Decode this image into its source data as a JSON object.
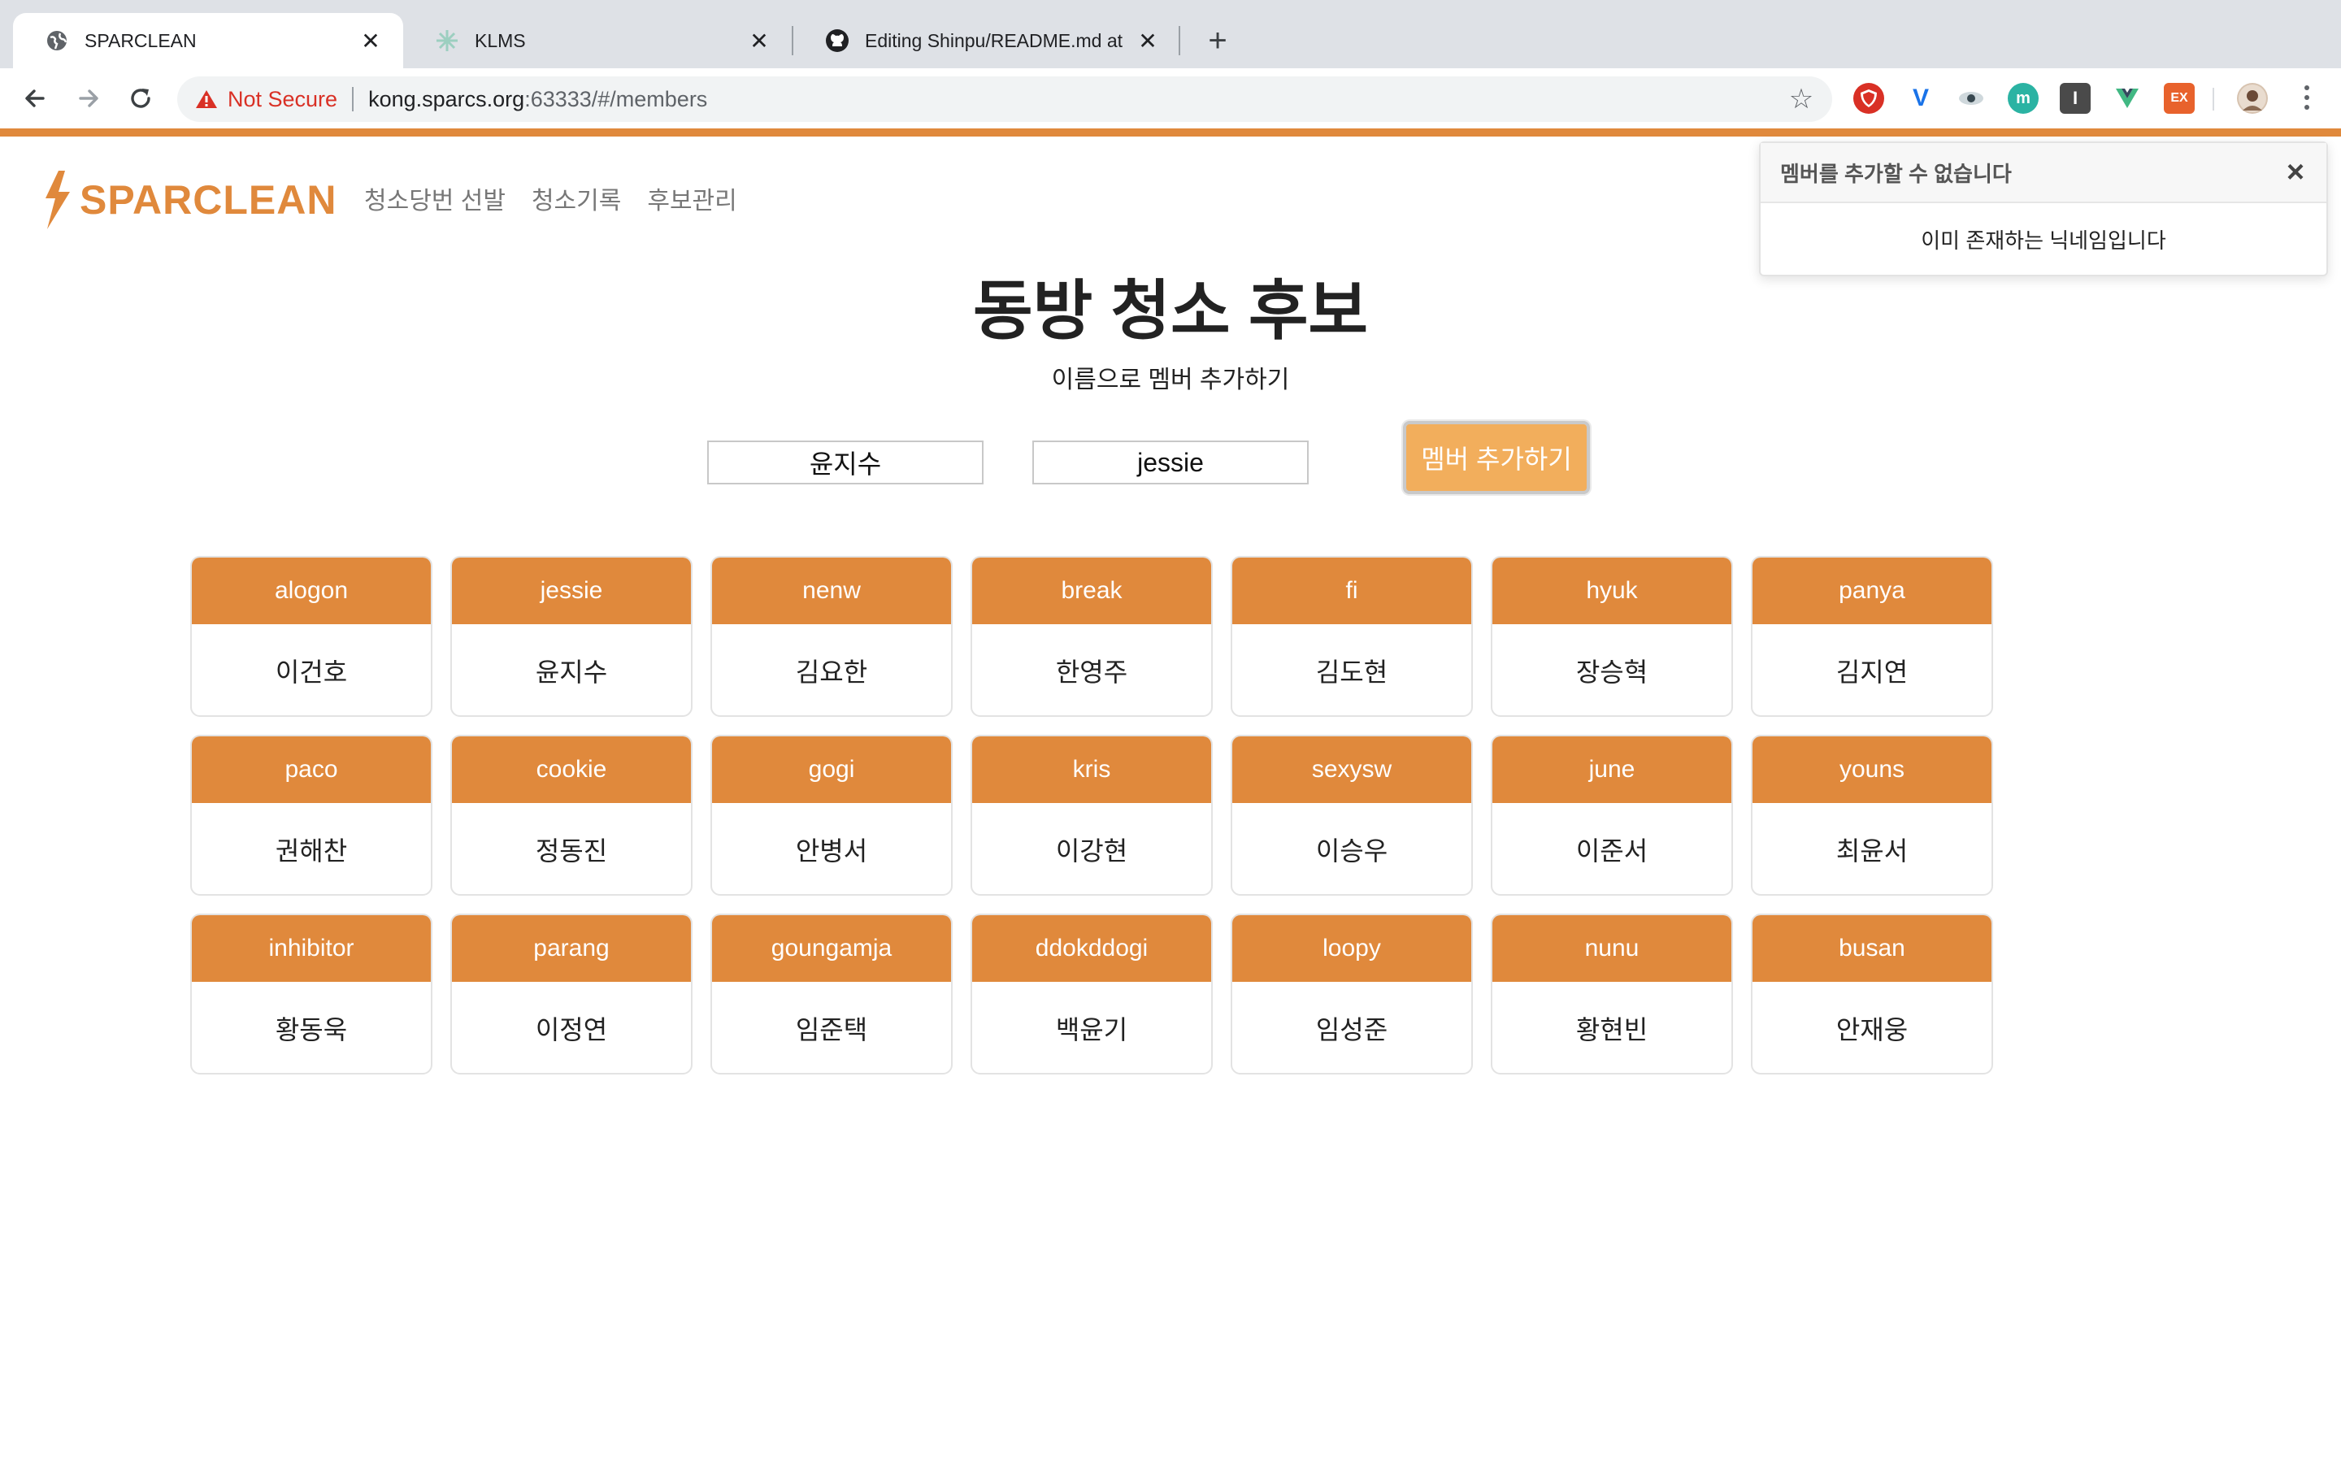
{
  "browser": {
    "tabs": [
      {
        "title": "SPARCLEAN",
        "icon": "globe-icon",
        "active": true
      },
      {
        "title": "KLMS",
        "icon": "klms-favicon",
        "active": false
      },
      {
        "title": "Editing Shinpu/README.md at",
        "icon": "github-icon",
        "active": false
      }
    ],
    "security_label": "Not Secure",
    "url_host": "kong.sparcs.org",
    "url_rest": ":63333/#/members",
    "extensions": [
      "ublock-icon",
      "vimeo-extension-icon",
      "eye-extension-icon",
      "teal-circle-extension-icon",
      "notion-icon",
      "vue-devtools-icon",
      "ex-extension-icon",
      "profile-avatar"
    ]
  },
  "app": {
    "brand": "SPARCLEAN",
    "accent_color": "#e0893c",
    "nav": [
      "청소당번 선발",
      "청소기록",
      "후보관리"
    ],
    "page_title": "동방 청소 후보",
    "subtitle": "이름으로 멤버 추가하기",
    "form": {
      "name_value": "윤지수",
      "nickname_value": "jessie",
      "submit_label": "멤버 추가하기"
    },
    "members": [
      {
        "nickname": "alogon",
        "name": "이건호"
      },
      {
        "nickname": "jessie",
        "name": "윤지수"
      },
      {
        "nickname": "nenw",
        "name": "김요한"
      },
      {
        "nickname": "break",
        "name": "한영주"
      },
      {
        "nickname": "fi",
        "name": "김도현"
      },
      {
        "nickname": "hyuk",
        "name": "장승혁"
      },
      {
        "nickname": "panya",
        "name": "김지연"
      },
      {
        "nickname": "paco",
        "name": "권해찬"
      },
      {
        "nickname": "cookie",
        "name": "정동진"
      },
      {
        "nickname": "gogi",
        "name": "안병서"
      },
      {
        "nickname": "kris",
        "name": "이강현"
      },
      {
        "nickname": "sexysw",
        "name": "이승우"
      },
      {
        "nickname": "june",
        "name": "이준서"
      },
      {
        "nickname": "youns",
        "name": "최윤서"
      },
      {
        "nickname": "inhibitor",
        "name": "황동욱"
      },
      {
        "nickname": "parang",
        "name": "이정연"
      },
      {
        "nickname": "goungamja",
        "name": "임준택"
      },
      {
        "nickname": "ddokddogi",
        "name": "백윤기"
      },
      {
        "nickname": "loopy",
        "name": "임성준"
      },
      {
        "nickname": "nunu",
        "name": "황현빈"
      },
      {
        "nickname": "busan",
        "name": "안재웅"
      }
    ],
    "toast": {
      "title": "멤버를 추가할 수 없습니다",
      "message": "이미 존재하는 닉네임입니다"
    }
  }
}
